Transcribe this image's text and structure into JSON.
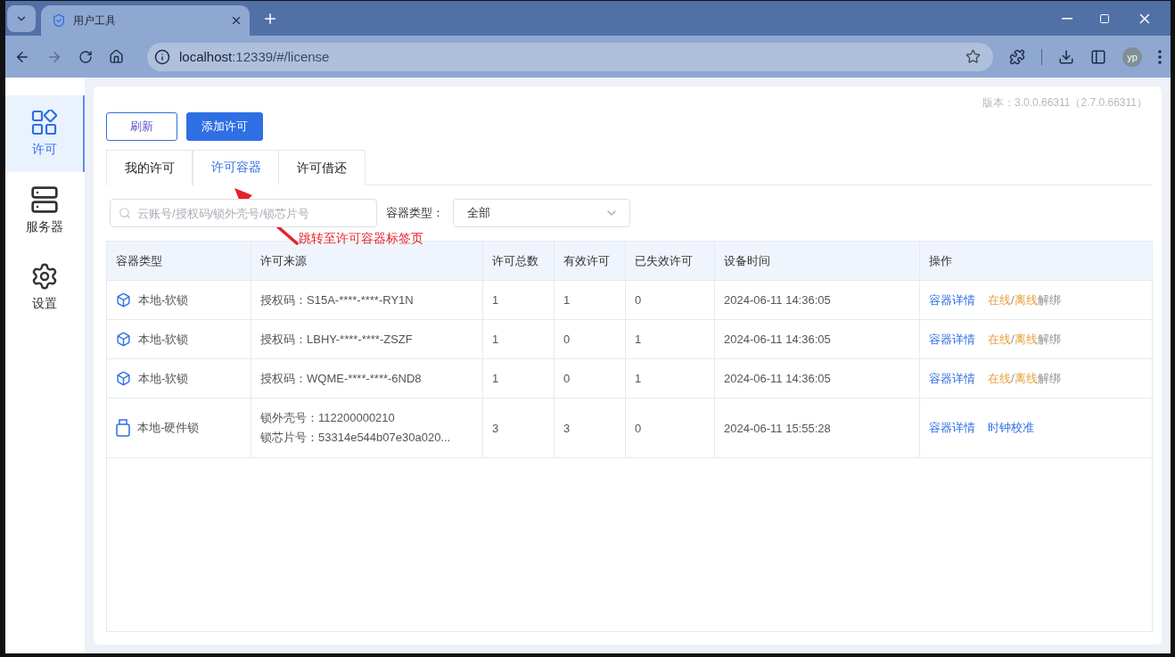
{
  "browser": {
    "tab_title": "用户工具",
    "url_host": "localhost",
    "url_rest": ":12339/#/license",
    "avatar": "yp"
  },
  "sidebar": {
    "items": [
      {
        "label": "许可",
        "kind": "grid",
        "selected": true
      },
      {
        "label": "服务器",
        "kind": "server",
        "selected": false
      },
      {
        "label": "设置",
        "kind": "gear",
        "selected": false
      }
    ]
  },
  "version": "版本：3.0.0.66311（2.7.0.66311）",
  "buttons": [
    {
      "label": "刷新",
      "kind": "outline"
    },
    {
      "label": "添加许可",
      "kind": "primary"
    }
  ],
  "tabs": [
    {
      "label": "我的许可",
      "selected": false
    },
    {
      "label": "许可容器",
      "selected": true
    },
    {
      "label": "许可借还",
      "selected": false
    }
  ],
  "search": {
    "placeholder": "云账号/授权码/锁外壳号/锁芯片号"
  },
  "filter": {
    "label": "容器类型：",
    "value": "全部"
  },
  "annotation": "跳转至许可容器标签页",
  "table": {
    "columns": [
      "容器类型",
      "许可来源",
      "许可总数",
      "有效许可",
      "已失效许可",
      "设备时间",
      "操作"
    ],
    "rows": [
      {
        "kind": "soft",
        "type": "本地-软锁",
        "source": [
          "授权码：S15A-****-****-RY1N"
        ],
        "total": "1",
        "valid": "1",
        "expired": "0",
        "time": "2024-06-11 14:36:05",
        "actions": [
          {
            "text": "容器详情",
            "kind": "link"
          },
          {
            "text": "在线",
            "kind": "warn"
          },
          {
            "text": "/",
            "kind": "plain"
          },
          {
            "text": "离线",
            "kind": "warn"
          },
          {
            "text": "解绑",
            "kind": "plain"
          }
        ]
      },
      {
        "kind": "soft",
        "type": "本地-软锁",
        "source": [
          "授权码：LBHY-****-****-ZSZF"
        ],
        "total": "1",
        "valid": "0",
        "expired": "1",
        "time": "2024-06-11 14:36:05",
        "actions": [
          {
            "text": "容器详情",
            "kind": "link"
          },
          {
            "text": "在线",
            "kind": "warn"
          },
          {
            "text": "/",
            "kind": "plain"
          },
          {
            "text": "离线",
            "kind": "warn"
          },
          {
            "text": "解绑",
            "kind": "plain"
          }
        ]
      },
      {
        "kind": "soft",
        "type": "本地-软锁",
        "source": [
          "授权码：WQME-****-****-6ND8"
        ],
        "total": "1",
        "valid": "0",
        "expired": "1",
        "time": "2024-06-11 14:36:05",
        "actions": [
          {
            "text": "容器详情",
            "kind": "link"
          },
          {
            "text": "在线",
            "kind": "warn"
          },
          {
            "text": "/",
            "kind": "plain"
          },
          {
            "text": "离线",
            "kind": "warn"
          },
          {
            "text": "解绑",
            "kind": "plain"
          }
        ]
      },
      {
        "kind": "hardware",
        "type": "本地-硬件锁",
        "source": [
          "锁外壳号：112200000210",
          "锁芯片号：53314e544b07e30a020..."
        ],
        "total": "3",
        "valid": "3",
        "expired": "0",
        "time": "2024-06-11 15:55:28",
        "actions": [
          {
            "text": "容器详情",
            "kind": "link"
          },
          {
            "text": "时钟校准",
            "kind": "link"
          }
        ]
      }
    ]
  }
}
